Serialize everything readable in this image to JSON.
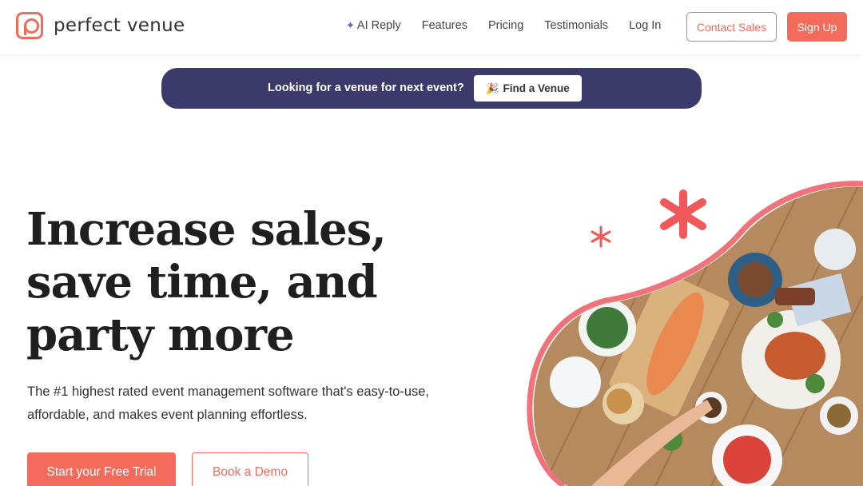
{
  "brand": {
    "name": "perfect venue",
    "accent": "#f26b5b",
    "banner_color": "#3b3a6a"
  },
  "nav": {
    "items": [
      {
        "label": "AI Reply",
        "icon": "sparkle-icon"
      },
      {
        "label": "Features"
      },
      {
        "label": "Pricing"
      },
      {
        "label": "Testimonials"
      },
      {
        "label": "Log In"
      }
    ],
    "contact_label": "Contact Sales",
    "signup_label": "Sign Up"
  },
  "banner": {
    "text": "Looking for a venue for next event?",
    "button_label": "Find a Venue",
    "button_icon": "🎉"
  },
  "hero": {
    "title": "Increase sales, save time, and party more",
    "subtitle": "The #1 highest rated event management software that's easy-to-use, affordable, and makes event planning effortless.",
    "primary_cta": "Start your Free Trial",
    "secondary_cta": "Book a Demo",
    "image_icon": "food-table-photo"
  }
}
